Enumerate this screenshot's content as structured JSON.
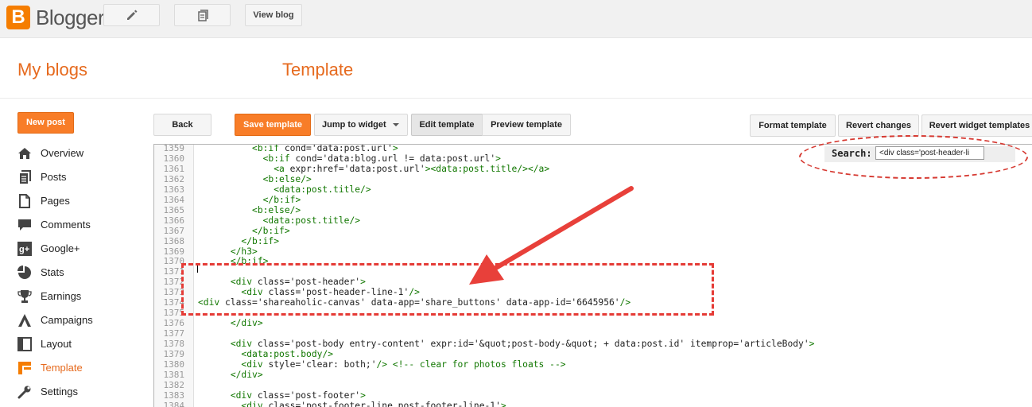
{
  "app": {
    "logo_letter": "B",
    "logo_text": "Blogger",
    "accent_color": "#f57d00"
  },
  "topbar": {
    "edit_icon": "pencil-icon",
    "pages_icon": "document-stack-icon",
    "view_blog_label": "View blog"
  },
  "header": {
    "my_blogs": "My blogs",
    "page_title": "Template"
  },
  "sidebar": {
    "new_post_label": "New post",
    "items": [
      {
        "label": "Overview",
        "icon": "home-icon"
      },
      {
        "label": "Posts",
        "icon": "posts-icon"
      },
      {
        "label": "Pages",
        "icon": "pages-icon"
      },
      {
        "label": "Comments",
        "icon": "comment-icon"
      },
      {
        "label": "Google+",
        "icon": "google-plus-icon"
      },
      {
        "label": "Stats",
        "icon": "stats-icon"
      },
      {
        "label": "Earnings",
        "icon": "trophy-icon"
      },
      {
        "label": "Campaigns",
        "icon": "campaigns-icon"
      },
      {
        "label": "Layout",
        "icon": "layout-icon"
      },
      {
        "label": "Template",
        "icon": "template-icon",
        "active": true
      },
      {
        "label": "Settings",
        "icon": "wrench-icon"
      }
    ]
  },
  "toolbar": {
    "back_label": "Back",
    "save_label": "Save template",
    "jump_label": "Jump to widget",
    "edit_label": "Edit template",
    "preview_label": "Preview template",
    "format_label": "Format template",
    "revert_label": "Revert changes",
    "revert_widgets_label": "Revert widget templates"
  },
  "search": {
    "label": "Search:",
    "value": "<div class='post-header-li"
  },
  "editor": {
    "line_numbers": [
      "1359",
      "1360",
      "1361",
      "1362",
      "1363",
      "1364",
      "1365",
      "1366",
      "1367",
      "1368",
      "1369",
      "1370",
      "1371",
      "1372",
      "1373",
      "1374",
      "1375",
      "1376",
      "1377",
      "1378",
      "1379",
      "1380",
      "1381",
      "1382",
      "1383",
      "1384"
    ],
    "lines": [
      "          <b:if cond='data:post.url'>",
      "            <b:if cond='data:blog.url != data:post.url'>",
      "              <a expr:href='data:post.url'><data:post.title/></a>",
      "            <b:else/>",
      "              <data:post.title/>",
      "            </b:if>",
      "          <b:else/>",
      "            <data:post.title/>",
      "          </b:if>",
      "        </b:if>",
      "      </h3>",
      "      </b:if>",
      "",
      "      <div class='post-header'>",
      "        <div class='post-header-line-1'/>",
      "<div class='shareaholic-canvas' data-app='share_buttons' data-app-id='6645956'/>",
      "",
      "      </div>",
      "",
      "      <div class='post-body entry-content' expr:id='&quot;post-body-&quot; + data:post.id' itemprop='articleBody'>",
      "        <data:post.body/>",
      "        <div style='clear: both;'/> <!-- clear for photos floats -->",
      "      </div>",
      "",
      "      <div class='post-footer'>",
      "        <div class='post-footer-line post-footer-line-1'>"
    ]
  }
}
